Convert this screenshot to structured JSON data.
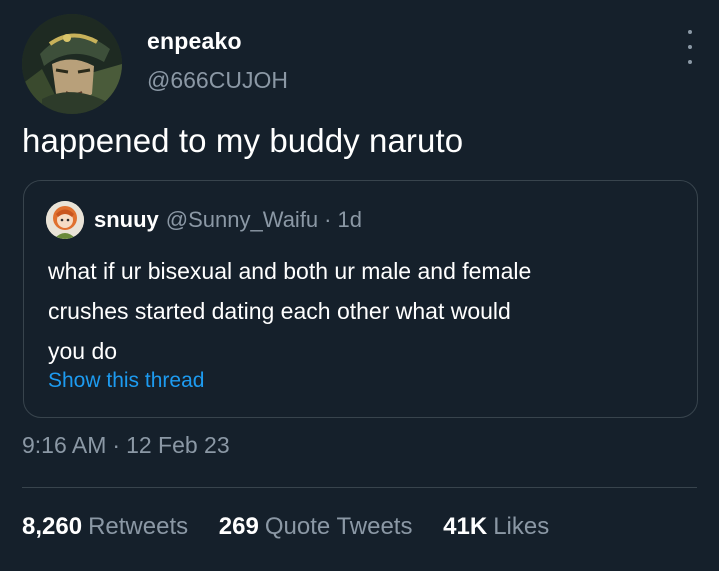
{
  "author": {
    "display_name": "enpeako",
    "handle": "@666CUJOH",
    "avatar_icon": "anime-character-avatar-icon"
  },
  "tweet": {
    "text": "happened to my buddy naruto",
    "time": "9:16 AM",
    "separator": "·",
    "date": "12 Feb 23"
  },
  "quoted": {
    "display_name": "snuuy",
    "handle": "@Sunny_Waifu",
    "separator": "·",
    "time": "1d",
    "text_lines": [
      "what if ur bisexual and both ur male and female",
      "crushes started dating each other what would",
      "you do"
    ],
    "link": "Show this thread",
    "avatar_icon": "orange-hair-avatar-icon"
  },
  "stats": [
    {
      "count": "8,260",
      "label": "Retweets"
    },
    {
      "count": "269",
      "label": "Quote Tweets"
    },
    {
      "count": "41K",
      "label": "Likes"
    }
  ],
  "colors": {
    "background": "#15202b",
    "text": "#ffffff",
    "secondary": "#8b98a5",
    "link": "#1d9bf0",
    "border": "#38444d"
  }
}
